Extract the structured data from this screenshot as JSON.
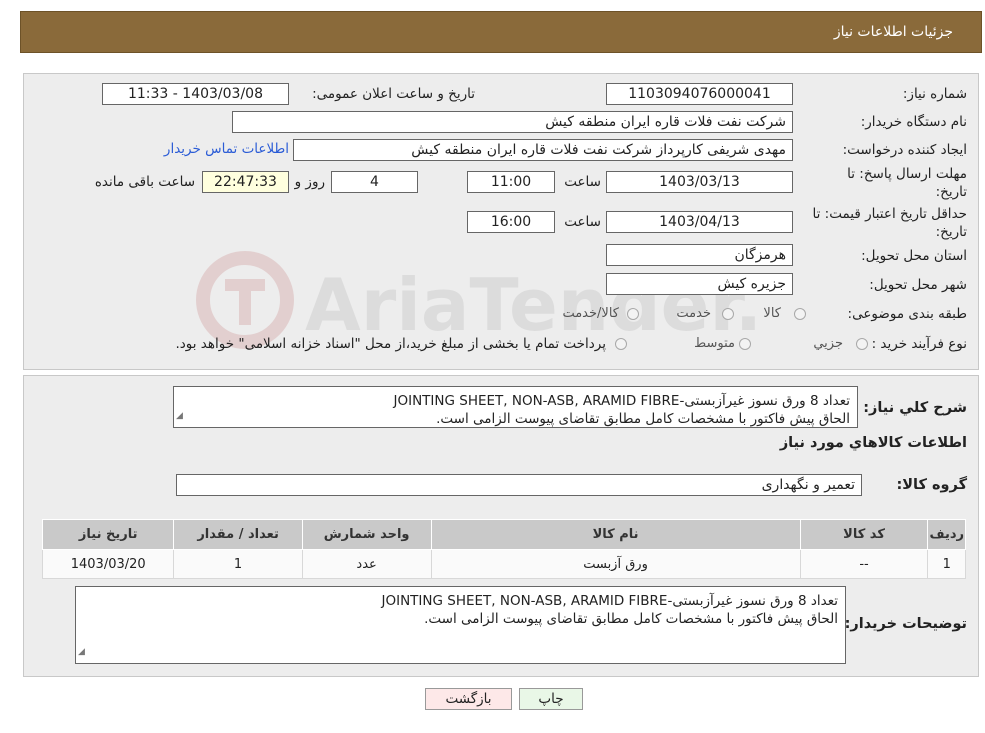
{
  "header": {
    "title": "جزئیات اطلاعات نیاز"
  },
  "fields": {
    "need_number_label": "شماره نیاز:",
    "need_number": "1103094076000041",
    "announce_label": "تاریخ و ساعت اعلان عمومی:",
    "announce_value": "1403/03/08 - 11:33",
    "buyer_label": "نام دستگاه خریدار:",
    "buyer_value": "شرکت نفت فلات قاره ایران منطقه کیش",
    "creator_label": "ایجاد کننده درخواست:",
    "creator_value": "مهدی شریفی کارپرداز شرکت نفت فلات قاره ایران منطقه کیش",
    "contact_link": "اطلاعات تماس خریدار",
    "deadline_label_1": "مهلت ارسال پاسخ: تا",
    "deadline_label_2": "تاریخ:",
    "deadline_date": "1403/03/13",
    "hour_label": "ساعت",
    "deadline_time": "11:00",
    "days_value": "4",
    "days_label": "روز و",
    "remaining_time": "22:47:33",
    "remaining_label": "ساعت باقی مانده",
    "validity_label_1": "حداقل تاریخ اعتبار قیمت: تا",
    "validity_label_2": "تاریخ:",
    "validity_date": "1403/04/13",
    "validity_time": "16:00",
    "province_label": "استان محل تحویل:",
    "province_value": "هرمزگان",
    "city_label": "شهر محل تحویل:",
    "city_value": "جزیره کیش",
    "category_label": "طبقه بندی موضوعی:",
    "category_options": [
      "کالا",
      "خدمت",
      "کالا/خدمت"
    ],
    "process_label": "نوع فرآیند خرید :",
    "process_options": [
      "جزیي",
      "متوسط"
    ],
    "process_note": "پرداخت تمام یا بخشی از مبلغ خرید،از محل \"اسناد خزانه اسلامی\" خواهد بود."
  },
  "summary": {
    "label": "شرح کلي نياز:",
    "line1": "تعداد 8 ورق نسوز غیرآزبستی-JOINTING SHEET, NON-ASB, ARAMID FIBRE",
    "line2": "الحاق پیش فاکتور با مشخصات کامل مطابق تقاضای پیوست الزامی است."
  },
  "goods": {
    "section_title": "اطلاعات کالاهاي مورد نياز",
    "group_label": "گروه کالا:",
    "group_value": "تعمیر و نگهداری"
  },
  "table": {
    "headers": [
      "رديف",
      "کد کالا",
      "نام کالا",
      "واحد شمارش",
      "تعداد / مقدار",
      "تاريخ نياز"
    ],
    "rows": [
      [
        "1",
        "--",
        "ورق آزبست",
        "عدد",
        "1",
        "1403/03/20"
      ]
    ]
  },
  "buyer_notes": {
    "label": "توضیحات خریدار:",
    "line1": "تعداد 8 ورق نسوز غیرآزبستی-JOINTING SHEET, NON-ASB, ARAMID FIBRE",
    "line2": "الحاق پیش فاکتور با مشخصات کامل مطابق تقاضای پیوست الزامی است."
  },
  "buttons": {
    "print": "چاپ",
    "back": "بازگشت"
  },
  "watermark": "AriaTender.neT",
  "colors": {
    "header_bg": "#8a6a3a",
    "panel_bg": "#ededed",
    "link": "#2b5cd6"
  }
}
